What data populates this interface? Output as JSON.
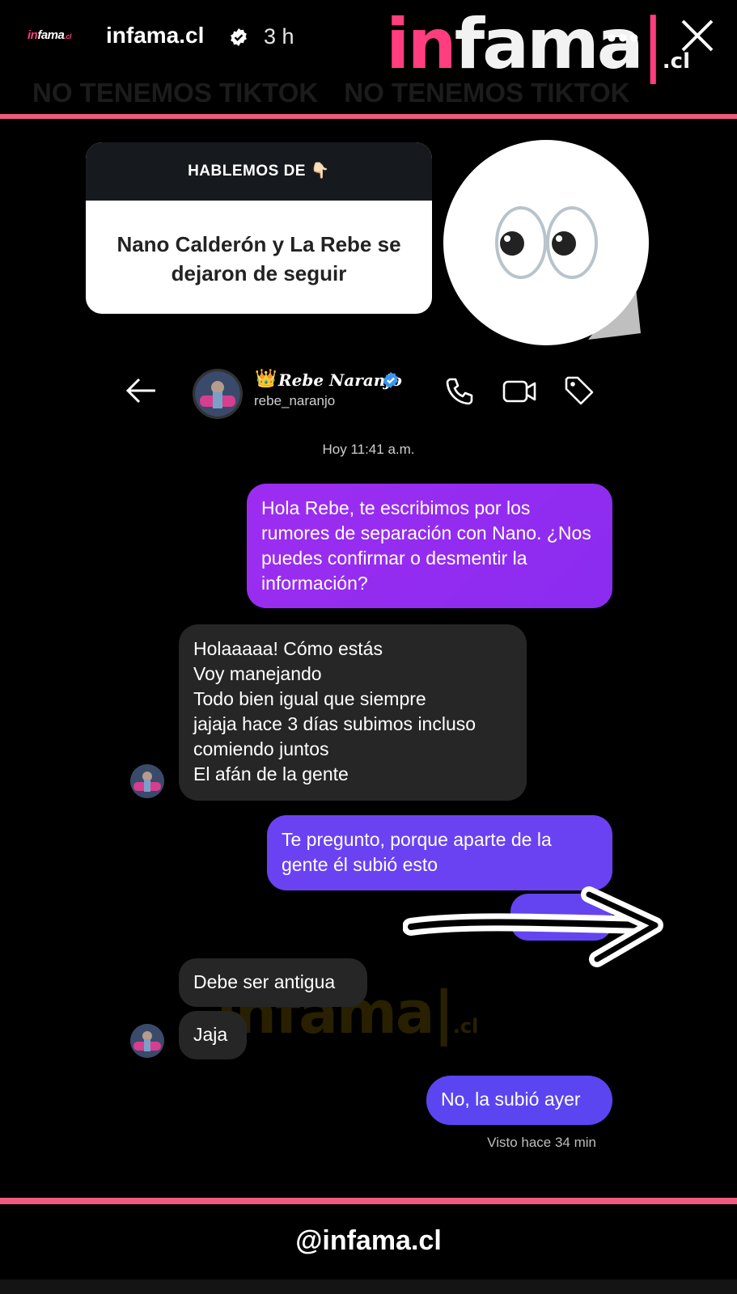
{
  "story": {
    "mini_logo": {
      "in": "in",
      "fama": "fama",
      "cl": ".cl"
    },
    "account_name": "infama.cl",
    "time_ago": "3 h",
    "brand_logo": {
      "in": "in",
      "fama": "fama",
      "bar": "|",
      "cl": ".cl"
    },
    "more_icon": "more-icon",
    "close_icon": "close-icon",
    "banner_text_1": "NO TENEMOS TIKTOK",
    "banner_text_2": "NO TENEMOS TIKTOK",
    "accent_color": "#f05a7e"
  },
  "question_sticker": {
    "header": "HABLEMOS DE 👇🏻",
    "body": "Nano Calderón y La Rebe se dejaron de seguir"
  },
  "eyes_sticker": {
    "icon": "eyes-emoji-icon"
  },
  "dm_header": {
    "crown": "👑",
    "display_name": "Rebe Naranjo",
    "username": "rebe_naranjo"
  },
  "chat": {
    "timestamp": "Hoy 11:41 a.m.",
    "messages": [
      {
        "from": "sent",
        "text": "Hola Rebe, te escribimos por los rumores de separación con Nano. ¿Nos puedes confirmar o desmentir la información?"
      },
      {
        "from": "received",
        "lines": [
          "Holaaaaa! Cómo estás",
          "Voy manejando",
          "Todo bien igual que siempre",
          "jajaja hace 3 días subimos incluso",
          "comiendo juntos",
          "El afán de la gente"
        ]
      },
      {
        "from": "sent",
        "text": "Te pregunto, porque aparte de la gente él subió esto"
      },
      {
        "from": "received",
        "text": "Debe ser antigua"
      },
      {
        "from": "received",
        "text": "Jaja"
      },
      {
        "from": "sent",
        "text": "No, la subió ayer"
      }
    ],
    "seen": "Visto hace 34 min",
    "watermark": {
      "main": "infama|",
      "cl": ".cl"
    }
  },
  "footer": {
    "handle": "@infama.cl"
  }
}
